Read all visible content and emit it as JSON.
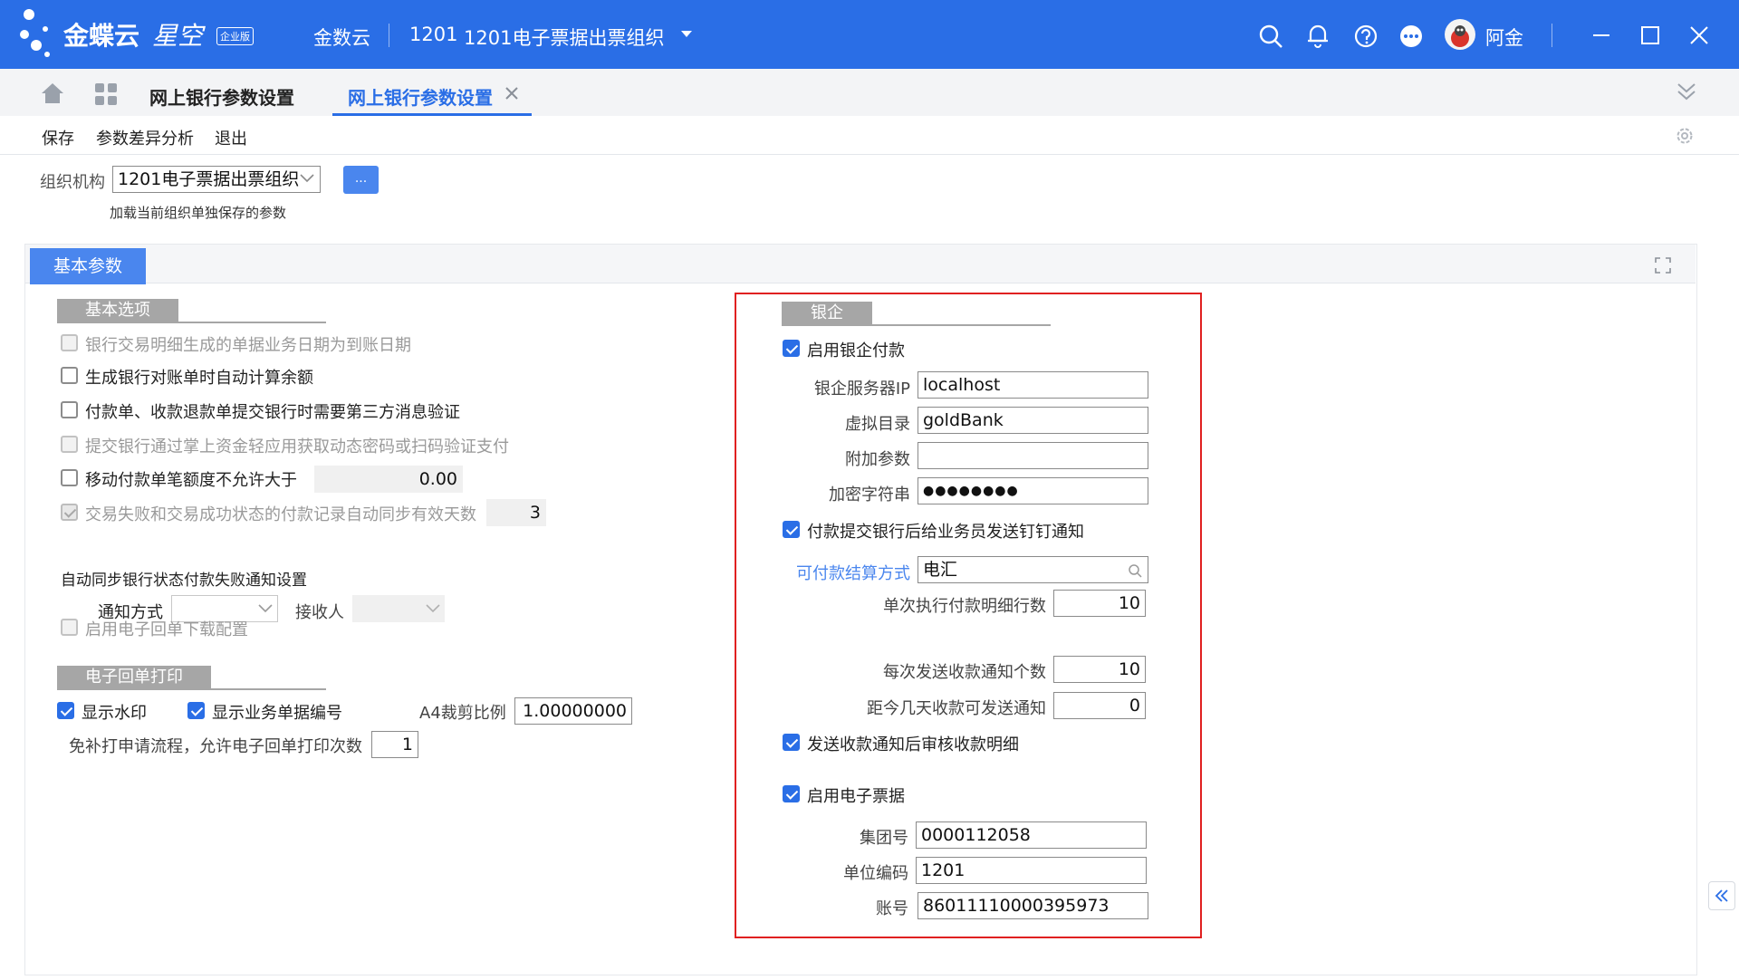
{
  "app": {
    "brand": "金蝶云",
    "brand2": "星空",
    "edition": "企业版",
    "env": "金数云",
    "org_code": "1201",
    "org_name": "1201电子票据出票组织",
    "user": "阿金",
    "accent": "#2a6ee6"
  },
  "tabs": {
    "home_title": "网上银行参数设置",
    "active": "网上银行参数设置"
  },
  "toolbar": {
    "save": "保存",
    "diff": "参数差异分析",
    "exit": "退出"
  },
  "org": {
    "label": "组织机构",
    "value": "1201电子票据出票组织",
    "browse": "...",
    "hint": "加载当前组织单独保存的参数"
  },
  "panel_tab": "基本参数",
  "basic": {
    "title": "基本选项",
    "options": [
      {
        "label": "银行交易明细生成的单据业务日期为到账日期",
        "checked": false,
        "disabled": true
      },
      {
        "label": "生成银行对账单时自动计算余额",
        "checked": false,
        "disabled": false
      },
      {
        "label": "付款单、收款退款单提交银行时需要第三方消息验证",
        "checked": false,
        "disabled": false
      },
      {
        "label": "提交银行通过掌上资金轻应用获取动态密码或扫码验证支付",
        "checked": false,
        "disabled": true
      },
      {
        "label": "移动付款单笔额度不允许大于",
        "checked": false,
        "disabled": false,
        "value": "0.00"
      },
      {
        "label": "交易失败和交易成功状态的付款记录自动同步有效天数",
        "checked": true,
        "disabled": true,
        "value": "3"
      }
    ]
  },
  "notify": {
    "title": "自动同步银行状态付款失败通知设置",
    "method_label": "通知方式",
    "method_value": "",
    "receiver_label": "接收人",
    "receiver_value": "",
    "receipt_download": "启用电子回单下载配置"
  },
  "print": {
    "title": "电子回单打印",
    "show_watermark": "显示水印",
    "show_billno": "显示业务单据编号",
    "a4_label": "A4裁剪比例",
    "a4_value": "1.00000000",
    "times_label": "免补打申请流程，允许电子回单打印次数",
    "times_value": "1"
  },
  "bank": {
    "title": "银企",
    "enable_pay": "启用银企付款",
    "server_ip_label": "银企服务器IP",
    "server_ip": "localhost",
    "vdir_label": "虚拟目录",
    "vdir": "goldBank",
    "extra_label": "附加参数",
    "extra": "",
    "secret_label": "加密字符串",
    "secret": "●●●●●●●●",
    "dingtalk": "付款提交银行后给业务员发送钉钉通知",
    "settle_label": "可付款结算方式",
    "settle_value": "电汇",
    "rows_label": "单次执行付款明细行数",
    "rows_value": "10",
    "notice_count_label": "每次发送收款通知个数",
    "notice_count_value": "10",
    "days_label": "距今几天收款可发送通知",
    "days_value": "0",
    "audit_after_send": "发送收款通知后审核收款明细",
    "enable_ebill": "启用电子票据",
    "group_label": "集团号",
    "group_value": "0000112058",
    "unit_label": "单位编码",
    "unit_value": "1201",
    "account_label": "账号",
    "account_value": "86011110000395973",
    "highlight_color": "#e02020"
  }
}
